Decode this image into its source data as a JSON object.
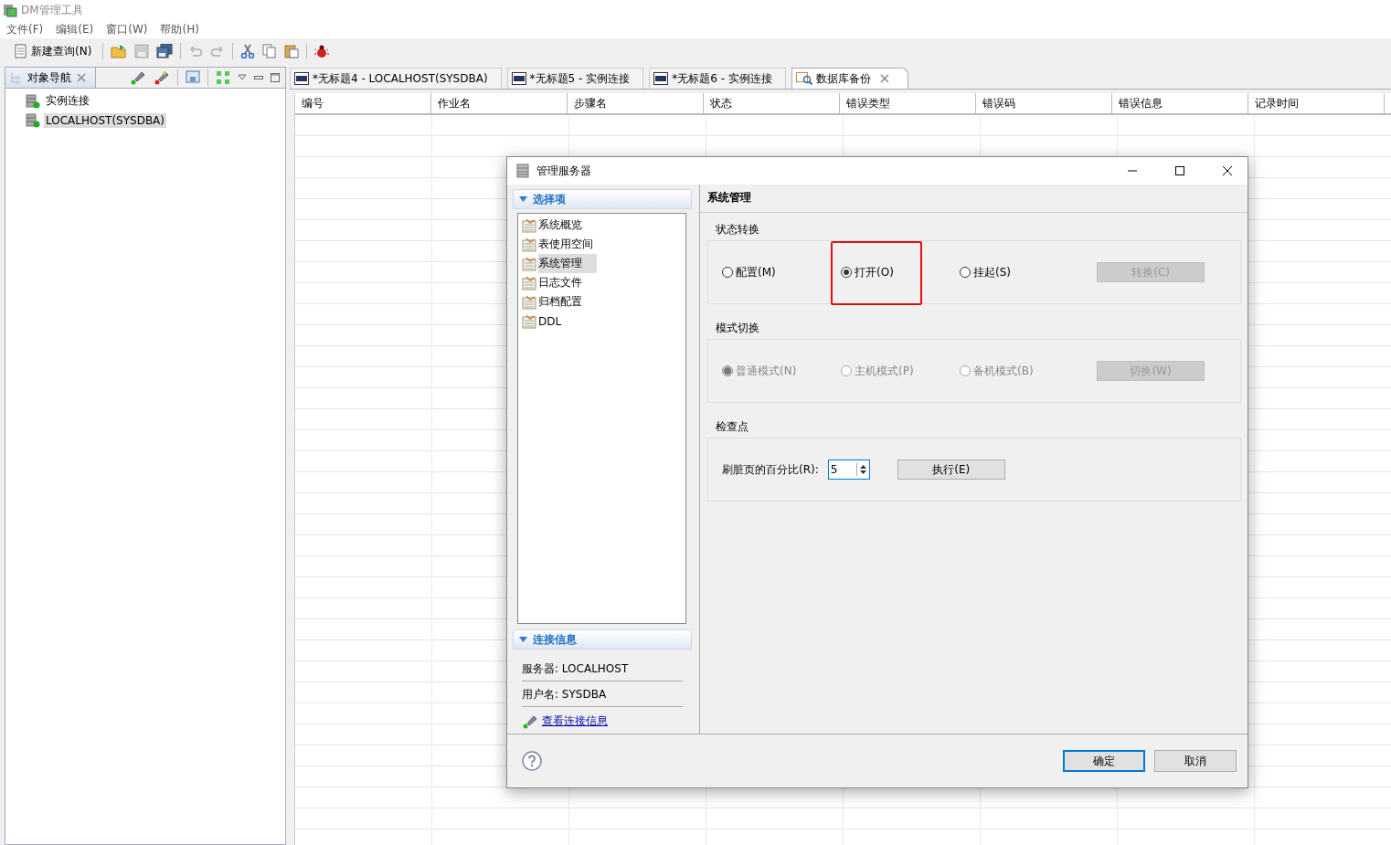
{
  "window": {
    "title": "DM管理工具"
  },
  "menu": [
    "文件(F)",
    "编辑(E)",
    "窗口(W)",
    "帮助(H)"
  ],
  "toolbar": {
    "new_query": "新建查询(N)"
  },
  "navigator": {
    "title": "对象导航",
    "items": [
      {
        "label": "实例连接",
        "selected": false
      },
      {
        "label": "LOCALHOST(SYSDBA)",
        "selected": true
      }
    ]
  },
  "editor_tabs": [
    {
      "label": "*无标题4 - LOCALHOST(SYSDBA)",
      "kind": "sql",
      "selected": false
    },
    {
      "label": "*无标题5 - 实例连接",
      "kind": "sql",
      "selected": false
    },
    {
      "label": "*无标题6 - 实例连接",
      "kind": "sql",
      "selected": false
    },
    {
      "label": "数据库备份",
      "kind": "backup",
      "selected": true
    }
  ],
  "table": {
    "columns": [
      "编号",
      "作业名",
      "步骤名",
      "状态",
      "错误类型",
      "错误码",
      "错误信息",
      "记录时间"
    ]
  },
  "dialog": {
    "title": "管理服务器",
    "options_header": "选择项",
    "options": [
      {
        "label": "系统概览",
        "selected": false
      },
      {
        "label": "表使用空间",
        "selected": false
      },
      {
        "label": "系统管理",
        "selected": true
      },
      {
        "label": "日志文件",
        "selected": false
      },
      {
        "label": "归档配置",
        "selected": false
      },
      {
        "label": "DDL",
        "selected": false
      }
    ],
    "connection_header": "连接信息",
    "connection_lines": [
      "服务器: LOCALHOST",
      "用户名: SYSDBA"
    ],
    "connection_link": "查看连接信息",
    "page_title": "系统管理",
    "groups": [
      {
        "title": "状态转换",
        "radios": [
          {
            "label": "配置(M)",
            "selected": false,
            "disabled": false,
            "highlighted": false
          },
          {
            "label": "打开(O)",
            "selected": true,
            "disabled": false,
            "highlighted": true
          },
          {
            "label": "挂起(S)",
            "selected": false,
            "disabled": false,
            "highlighted": false
          }
        ],
        "button": {
          "label": "转换(C)",
          "disabled": true
        }
      },
      {
        "title": "模式切换",
        "radios": [
          {
            "label": "普通模式(N)",
            "selected": true,
            "disabled": true,
            "highlighted": false
          },
          {
            "label": "主机模式(P)",
            "selected": false,
            "disabled": true,
            "highlighted": false
          },
          {
            "label": "备机模式(B)",
            "selected": false,
            "disabled": true,
            "highlighted": false
          }
        ],
        "button": {
          "label": "切换(W)",
          "disabled": true
        }
      }
    ],
    "checkpoint": {
      "title": "检查点",
      "label": "刷脏页的百分比(R):",
      "value": "5",
      "button": "执行(E)"
    },
    "ok": "确定",
    "cancel": "取消"
  }
}
